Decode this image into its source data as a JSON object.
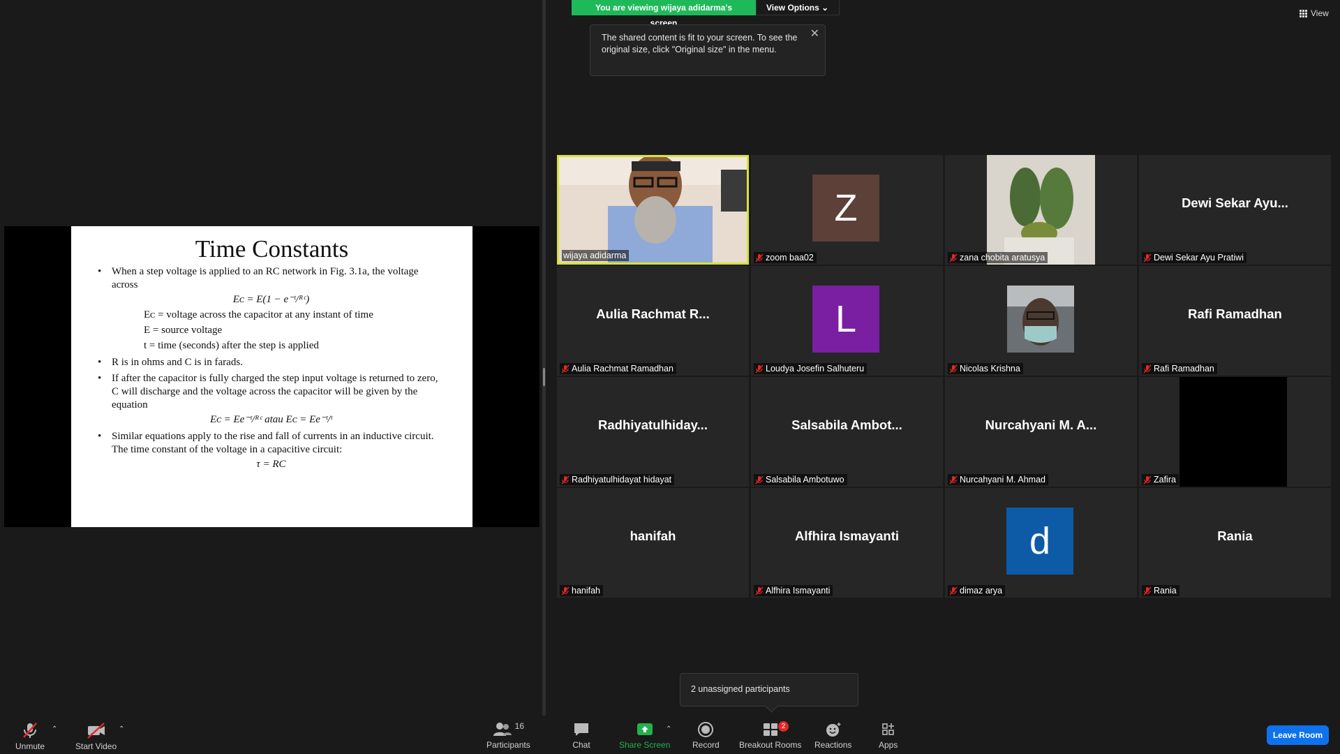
{
  "banner": {
    "viewing": "You are viewing wijaya adidarma's screen",
    "view_options": "View Options"
  },
  "tooltip": {
    "text": "The shared content is fit to your screen. To see the original size, click \"Original size\" in the menu."
  },
  "view_button": "View",
  "slide": {
    "title": "Time Constants",
    "b1": "When a step voltage is applied to an RC network in Fig. 3.1a, the voltage across",
    "eq1": "Eᴄ = E(1 − e⁻ᵗ/ᴿᶜ)",
    "d1": "Eᴄ = voltage across the capacitor at any instant of time",
    "d2": "E = source voltage",
    "d3": "t = time (seconds) after the step is applied",
    "b2": "R is in ohms and C is in farads.",
    "b3": "If after the capacitor is fully charged the step input voltage is returned to zero, C will discharge and the voltage across the capacitor will be given by the equation",
    "eq2": "Eᴄ = Ee⁻ᵗ/ᴿᶜ    atau    Eᴄ = Ee⁻ᵗ/ᵗ",
    "b4": "Similar equations apply to the rise and fall of currents in an inductive circuit. The time constant of the voltage in a capacitive circuit:",
    "eq3": "τ = RC"
  },
  "tiles": [
    {
      "label": "wijaya adidarma",
      "big": "",
      "avatar": "",
      "color": "",
      "kind": "video-person"
    },
    {
      "label": "zoom baa02",
      "big": "",
      "avatar": "Z",
      "color": "#5d4037",
      "kind": "avatar"
    },
    {
      "label": "zana chobita aratusya",
      "big": "",
      "avatar": "",
      "color": "",
      "kind": "video-cactus"
    },
    {
      "label": "Dewi Sekar Ayu Pratiwi",
      "big": "Dewi Sekar Ayu...",
      "avatar": "",
      "color": "",
      "kind": "name"
    },
    {
      "label": "Aulia Rachmat Ramadhan",
      "big": "Aulia Rachmat R...",
      "avatar": "",
      "color": "",
      "kind": "name"
    },
    {
      "label": "Loudya Josefin Salhuteru",
      "big": "",
      "avatar": "L",
      "color": "#7b1fa2",
      "kind": "avatar"
    },
    {
      "label": "Nicolas Krishna",
      "big": "",
      "avatar": "",
      "color": "",
      "kind": "video-mask"
    },
    {
      "label": "Rafi Ramadhan",
      "big": "Rafi Ramadhan",
      "avatar": "",
      "color": "",
      "kind": "name"
    },
    {
      "label": "Radhiyatulhidayat hidayat",
      "big": "Radhiyatulhiday...",
      "avatar": "",
      "color": "",
      "kind": "name"
    },
    {
      "label": "Salsabila Ambotuwo",
      "big": "Salsabila Ambot...",
      "avatar": "",
      "color": "",
      "kind": "name"
    },
    {
      "label": "Nurcahyani M. Ahmad",
      "big": "Nurcahyani M. A...",
      "avatar": "",
      "color": "",
      "kind": "name"
    },
    {
      "label": "Zafira",
      "big": "",
      "avatar": "",
      "color": "",
      "kind": "video-black"
    },
    {
      "label": "hanifah",
      "big": "hanifah",
      "avatar": "",
      "color": "",
      "kind": "name"
    },
    {
      "label": "Alfhira Ismayanti",
      "big": "Alfhira Ismayanti",
      "avatar": "",
      "color": "",
      "kind": "name"
    },
    {
      "label": "dimaz arya",
      "big": "",
      "avatar": "d",
      "color": "#0d5aa7",
      "kind": "avatar"
    },
    {
      "label": "Rania",
      "big": "Rania",
      "avatar": "",
      "color": "",
      "kind": "name"
    }
  ],
  "unassigned": "2 unassigned participants",
  "toolbar": {
    "unmute": "Unmute",
    "start_video": "Start Video",
    "participants": "Participants",
    "participants_count": "16",
    "chat": "Chat",
    "share_screen": "Share Screen",
    "record": "Record",
    "breakout_rooms": "Breakout Rooms",
    "breakout_badge": "2",
    "reactions": "Reactions",
    "apps": "Apps",
    "leave": "Leave Room"
  }
}
